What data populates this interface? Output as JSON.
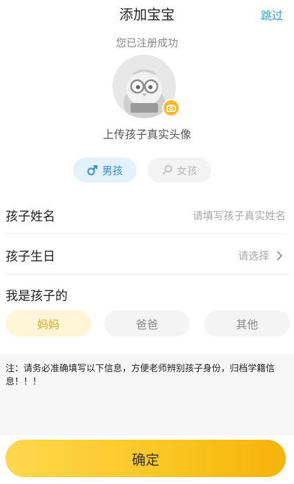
{
  "header": {
    "title": "添加宝宝",
    "skip_label": "跳过"
  },
  "registered_text": "您已注册成功",
  "avatar": {
    "upload_label": "上传孩子真实头像"
  },
  "gender": {
    "boy_label": "男孩",
    "girl_label": "女孩",
    "selected": "boy"
  },
  "form": {
    "name": {
      "label": "孩子姓名",
      "placeholder": "请填写孩子真实姓名"
    },
    "birthday": {
      "label": "孩子生日",
      "placeholder": "请选择"
    }
  },
  "relation": {
    "label": "我是孩子的",
    "options": [
      "妈妈",
      "爸爸",
      "其他"
    ],
    "selected": "妈妈"
  },
  "note": "注：请务必准确填写以下信息，方便老师辨别孩子身份，归档学籍信息！！！",
  "confirm_label": "确定",
  "colors": {
    "accent_blue": "#27a3e6",
    "accent_yellow": "#fac51f"
  }
}
